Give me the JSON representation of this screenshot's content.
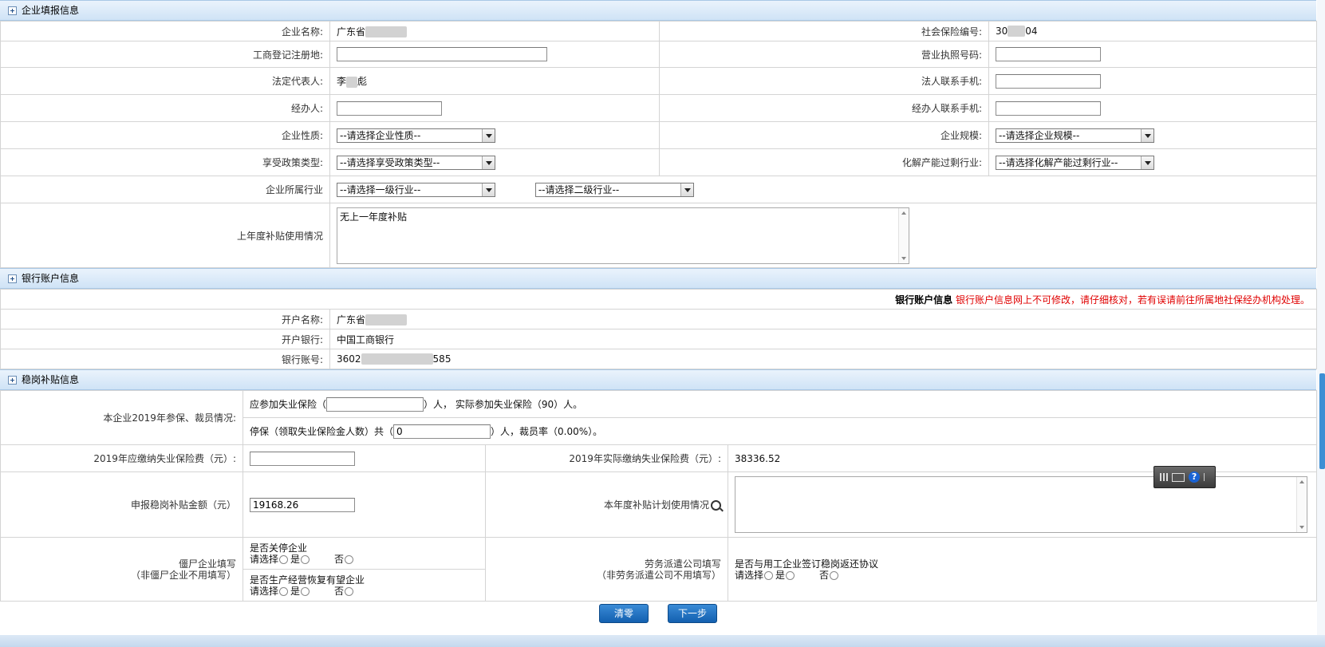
{
  "sections": {
    "enterprise": "企业填报信息",
    "bank": "银行账户信息",
    "subsidy": "稳岗补贴信息"
  },
  "enterprise": {
    "name_label": "企业名称:",
    "name_value": "广东省",
    "insurance_no_label": "社会保险编号:",
    "insurance_no_prefix": "30",
    "insurance_no_suffix": "04",
    "reg_addr_label": "工商登记注册地:",
    "license_label": "营业执照号码:",
    "legal_rep_label": "法定代表人:",
    "legal_rep_value_a": "李",
    "legal_rep_value_b": "彪",
    "legal_phone_label": "法人联系手机:",
    "handler_label": "经办人:",
    "handler_phone_label": "经办人联系手机:",
    "nature_label": "企业性质:",
    "nature_select": "--请选择企业性质--",
    "scale_label": "企业规模:",
    "scale_select": "--请选择企业规模--",
    "policy_label": "享受政策类型:",
    "policy_select": "--请选择享受政策类型--",
    "overcap_label": "化解产能过剩行业:",
    "overcap_select": "--请选择化解产能过剩行业--",
    "industry_label": "企业所属行业",
    "industry1_select": "--请选择一级行业--",
    "industry2_select": "--请选择二级行业--",
    "last_year_label": "上年度补贴使用情况",
    "last_year_value": "无上一年度补贴"
  },
  "bank": {
    "notice_bold": "银行账户信息",
    "notice_red": "银行账户信息网上不可修改，请仔细核对，若有误请前往所属地社保经办机构处理。",
    "acct_name_label": "开户名称:",
    "acct_name_value": "广东省",
    "bank_label": "开户银行:",
    "bank_value": "中国工商银行",
    "acct_no_label": "银行账号:",
    "acct_no_prefix": "3602",
    "acct_no_suffix": "585"
  },
  "subsidy": {
    "staff_label": "本企业2019年参保、裁员情况:",
    "should_insured_pre": "应参加失业保险（",
    "should_insured_post": "）人，  实际参加失业保险（90）人。",
    "stop_pre": "停保（领取失业保险金人数）共（",
    "stop_value": "0",
    "stop_post": "）人，裁员率（0.00%）。",
    "should_fee_label": "2019年应缴纳失业保险费（元）:",
    "actual_fee_label": "2019年实际缴纳失业保险费（元）:",
    "actual_fee_value": "38336.52",
    "apply_amount_label": "申报稳岗补贴金额（元）",
    "apply_amount_value": "19168.26",
    "plan_label": "本年度补贴计划使用情况",
    "zombie_label1": "僵尸企业填写",
    "zombie_label2": "（非僵尸企业不用填写）",
    "zombie_q1": "是否关停企业",
    "zombie_q2": "是否生产经营恢复有望企业",
    "choose": "请选择",
    "yes": "是",
    "no": "否",
    "dispatch_label1": "劳务派遣公司填写",
    "dispatch_label2": "（非劳务派遣公司不用填写）",
    "dispatch_q": "是否与用工企业签订稳岗返还协议"
  },
  "buttons": {
    "clear": "清零",
    "next": "下一步"
  },
  "colors": {
    "accent": "#1360b0",
    "warning": "#e00000"
  }
}
